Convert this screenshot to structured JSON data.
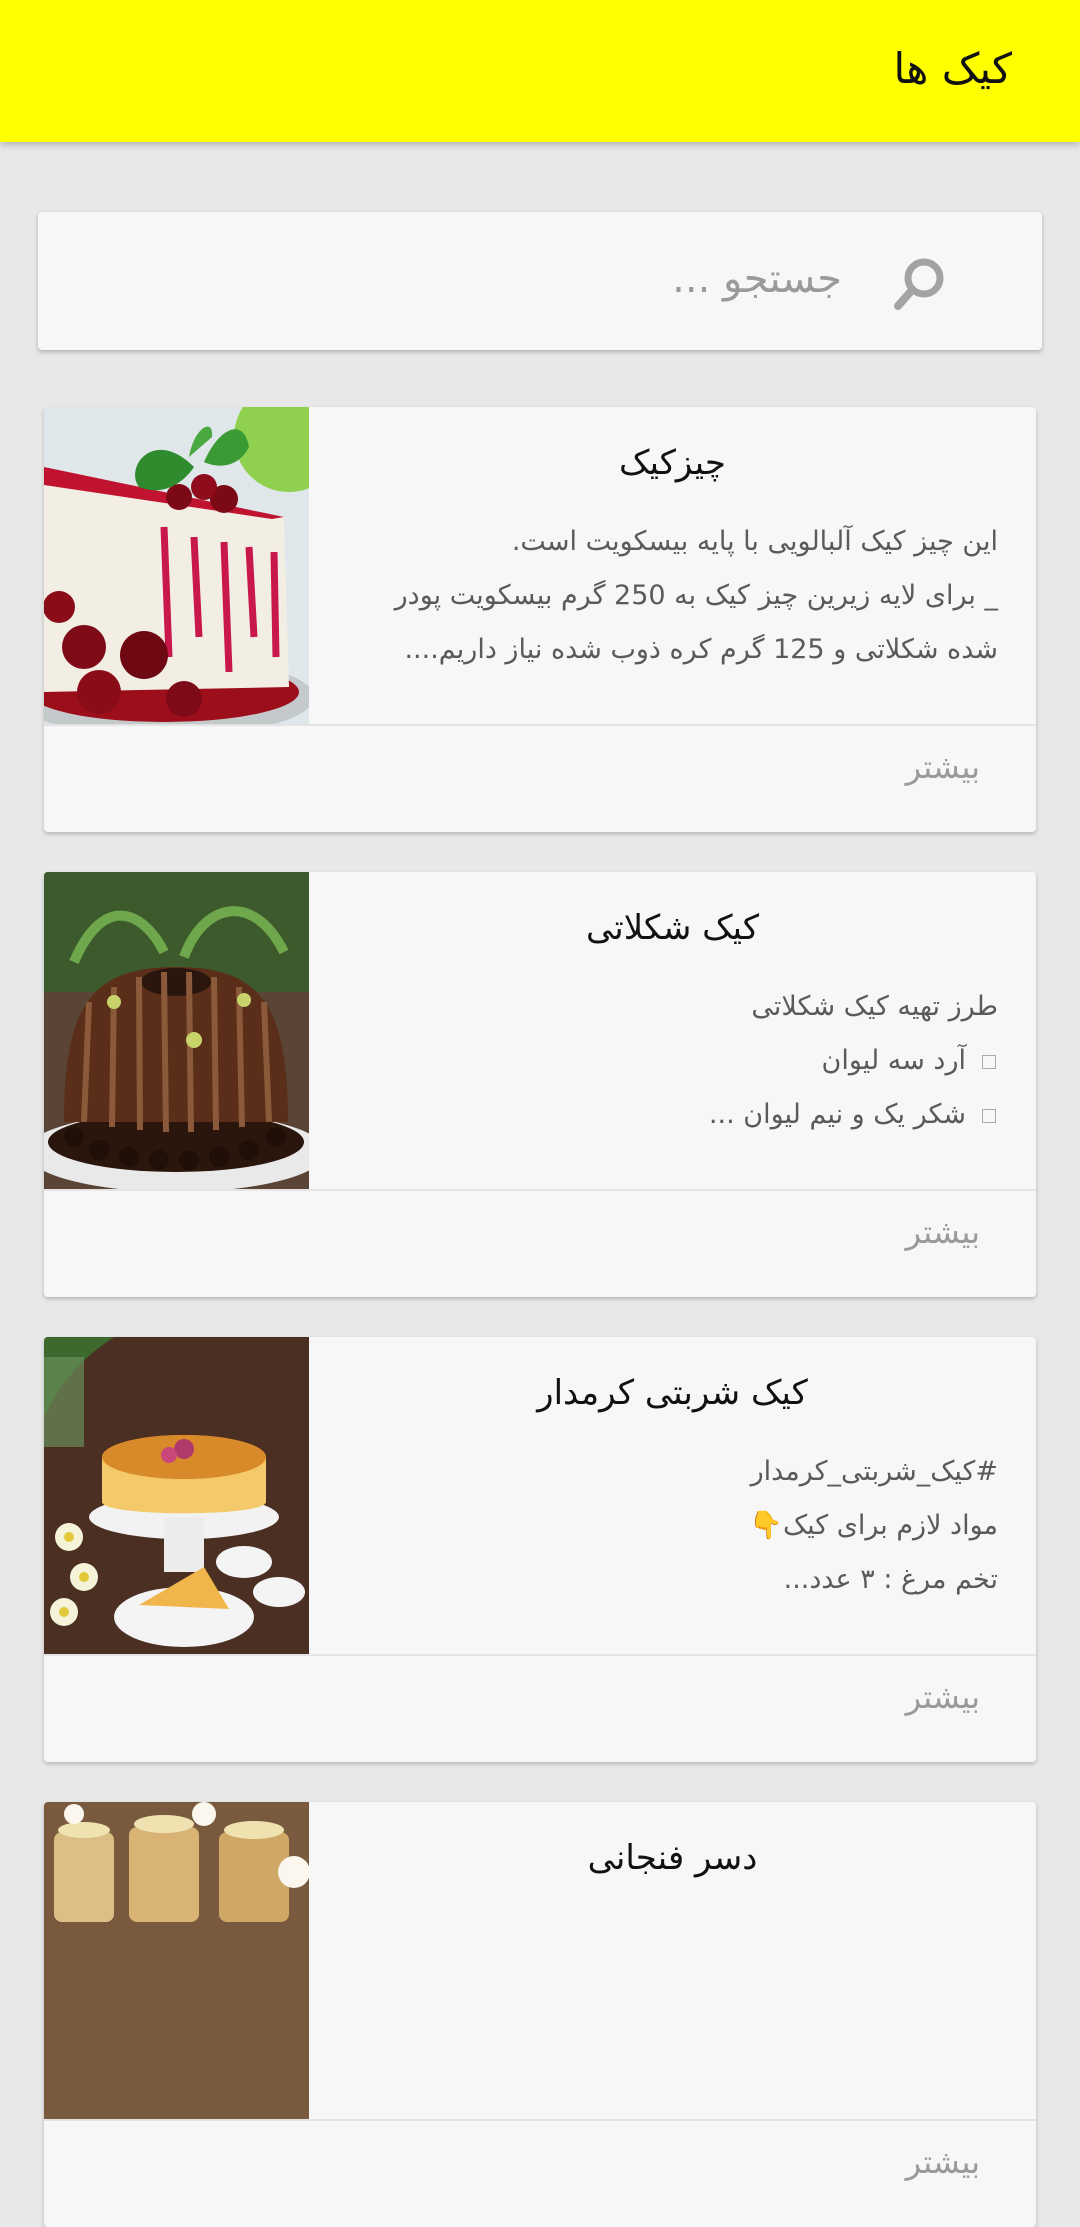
{
  "appbar": {
    "title": "کیک ها",
    "color": "#ffff00"
  },
  "search": {
    "placeholder": "جستجو ...",
    "icon": "search-icon"
  },
  "cards": [
    {
      "title": "چیزکیک",
      "lines": [
        "این چیز کیک آلبالویی با پایه بیسکویت است.",
        "_ برای لایه زیرین چیز کیک به  250 گرم بیسکویت پودر",
        "شده شکلاتی و 125 گرم کره ذوب شده نیاز داریم...."
      ],
      "more": "بیشتر"
    },
    {
      "title": "کیک شکلاتی",
      "lines": [
        "طرز تهیه کیک شکلاتی",
        "آرد سه لیوان",
        "شکر یک و نیم لیوان ..."
      ],
      "more": "بیشتر"
    },
    {
      "title": "کیک شربتی کرمدار",
      "lines": [
        "#کیک_شربتی_کرمدار",
        "مواد لازم برای کیک👇",
        "تخم مرغ : ۳ عدد..."
      ],
      "more": "بیشتر"
    },
    {
      "title": "دسر فنجانی",
      "more": "بیشتر"
    }
  ]
}
